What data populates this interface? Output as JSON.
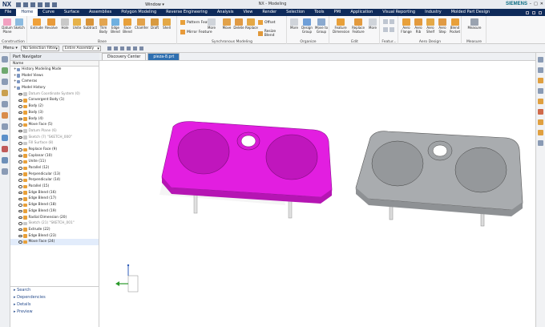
{
  "titlebar": {
    "logo": "NX",
    "window_menu": "Window ▾",
    "title": "NX - Modeling",
    "brand": "SIEMENS"
  },
  "menubar": {
    "items": [
      "File",
      "Home",
      "Curve",
      "Surface",
      "Assemblies",
      "Polygon Modeling",
      "Reverse Engineering",
      "Analysis",
      "View",
      "Render",
      "Selection",
      "Tools",
      "PMI",
      "Application",
      "Visual Reporting",
      "Industry",
      "Molded Part Design"
    ],
    "active": "Home"
  },
  "ribbon": {
    "groups": [
      {
        "label": "Construction",
        "tools": [
          "Datum Plane",
          "Sketch"
        ]
      },
      {
        "label": "Base",
        "tools": [
          "Extrude",
          "Revolve",
          "Hole",
          "Unite",
          "Subtract",
          "Trim Body",
          "Edge Blend",
          "Face Blend",
          "Chamfer",
          "Draft",
          "Shell"
        ]
      },
      {
        "label": "Synchronous Modeling",
        "tools": [
          "Pattern Feature",
          "Mirror Feature",
          "More",
          "Move",
          "Delete",
          "Replace",
          "Offset",
          "Resize Blend"
        ]
      },
      {
        "label": "Organize",
        "tools": [
          "More",
          "Design Group",
          "Move to Group"
        ]
      },
      {
        "label": "Edit",
        "tools": [
          "Feature Dimension",
          "Replace Feature",
          "More"
        ]
      },
      {
        "label": "Featur...",
        "tools": []
      },
      {
        "label": "Aero Design",
        "tools": [
          "Aero Flange",
          "Aero Rib",
          "Aero Shelf",
          "Aero Step",
          "Blend Pocket"
        ]
      },
      {
        "label": "Measure",
        "tools": [
          "Measure"
        ]
      }
    ]
  },
  "selection_bar": {
    "menu": "Menu ▾",
    "filter": "No Selection Filter",
    "scope": "Entire Assembly"
  },
  "part_navigator": {
    "title": "Part Navigator",
    "column": "Name",
    "rows": [
      {
        "label": "History Modeling Mode",
        "indent": 1,
        "style": "normal"
      },
      {
        "label": "Model Views",
        "indent": 1,
        "style": "normal"
      },
      {
        "label": "Cameras",
        "indent": 1,
        "style": "normal"
      },
      {
        "label": "Model History",
        "indent": 1,
        "style": "normal"
      },
      {
        "label": "Datum Coordinate System (0)",
        "indent": 2,
        "style": "gray"
      },
      {
        "label": "Convergent Body (1)",
        "indent": 2,
        "style": "normal"
      },
      {
        "label": "Body (2)",
        "indent": 2,
        "style": "normal"
      },
      {
        "label": "Body (3)",
        "indent": 2,
        "style": "normal"
      },
      {
        "label": "Body (4)",
        "indent": 2,
        "style": "normal"
      },
      {
        "label": "Move Face (5)",
        "indent": 2,
        "style": "normal"
      },
      {
        "label": "Datum Plane (6)",
        "indent": 2,
        "style": "gray"
      },
      {
        "label": "Sketch (7) \"SKETCH_000\"",
        "indent": 2,
        "style": "gray"
      },
      {
        "label": "Fill Surface (8)",
        "indent": 2,
        "style": "gray"
      },
      {
        "label": "Replace Face (9)",
        "indent": 2,
        "style": "normal"
      },
      {
        "label": "Coplanar (10)",
        "indent": 2,
        "style": "normal"
      },
      {
        "label": "Unite (11)",
        "indent": 2,
        "style": "normal"
      },
      {
        "label": "Parallel (12)",
        "indent": 2,
        "style": "normal"
      },
      {
        "label": "Perpendicular (13)",
        "indent": 2,
        "style": "normal"
      },
      {
        "label": "Perpendicular (14)",
        "indent": 2,
        "style": "normal"
      },
      {
        "label": "Parallel (15)",
        "indent": 2,
        "style": "normal"
      },
      {
        "label": "Edge Blend (16)",
        "indent": 2,
        "style": "normal"
      },
      {
        "label": "Edge Blend (17)",
        "indent": 2,
        "style": "normal"
      },
      {
        "label": "Edge Blend (18)",
        "indent": 2,
        "style": "normal"
      },
      {
        "label": "Edge Blend (19)",
        "indent": 2,
        "style": "normal"
      },
      {
        "label": "Radial Dimension (20)",
        "indent": 2,
        "style": "normal"
      },
      {
        "label": "Sketch (21) \"SKETCH_001\"",
        "indent": 2,
        "style": "gray"
      },
      {
        "label": "Extrude (22)",
        "indent": 2,
        "style": "normal"
      },
      {
        "label": "Edge Blend (23)",
        "indent": 2,
        "style": "normal"
      },
      {
        "label": "Move Face (24)",
        "indent": 2,
        "style": "selected"
      }
    ],
    "bottom_links": [
      "Search",
      "Dependencies",
      "Details",
      "Preview"
    ]
  },
  "tabs": [
    "Discovery Center",
    "pieza-8.prt"
  ],
  "active_tab": "pieza-8.prt",
  "colors": {
    "selected_body": "#e21ee0",
    "other_body": "#a9acaf",
    "menubar": "#0e2a5a"
  }
}
